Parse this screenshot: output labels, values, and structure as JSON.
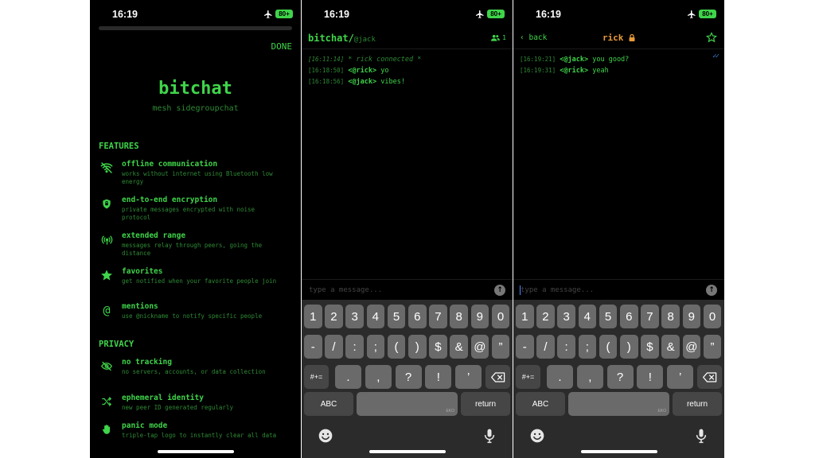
{
  "status": {
    "time": "16:19",
    "battery": "80+",
    "icons": [
      "airplane-icon",
      "battery-icon"
    ]
  },
  "settings": {
    "done_label": "DONE",
    "app_title": "bitchat",
    "app_subtitle": "mesh sidegroupchat",
    "features_header": "FEATURES",
    "privacy_header": "PRIVACY",
    "features": [
      {
        "icon": "wifi-off-icon",
        "title": "offline communication",
        "desc": "works without internet using Bluetooth low energy"
      },
      {
        "icon": "shield-icon",
        "title": "end-to-end encryption",
        "desc": "private messages encrypted with noise protocol"
      },
      {
        "icon": "antenna-icon",
        "title": "extended range",
        "desc": "messages relay through peers, going the distance"
      },
      {
        "icon": "star-icon",
        "title": "favorites",
        "desc": "get notified when your favorite people join"
      },
      {
        "icon": "at-icon",
        "title": "mentions",
        "desc": "use @nickname to notify specific people"
      }
    ],
    "privacy": [
      {
        "icon": "eye-slash-icon",
        "title": "no tracking",
        "desc": "no servers, accounts, or data collection"
      },
      {
        "icon": "shuffle-icon",
        "title": "ephemeral identity",
        "desc": "new peer ID generated regularly"
      },
      {
        "icon": "hand-icon",
        "title": "panic mode",
        "desc": "triple-tap logo to instantly clear all data"
      }
    ]
  },
  "public_chat": {
    "title": "bitchat/",
    "handle": "@jack",
    "peer_count": "1",
    "messages": [
      {
        "ts": "[16:11:14]",
        "text": "* rick connected *",
        "system": true
      },
      {
        "ts": "[16:18:50]",
        "nick": "<@rick>",
        "text": "yo"
      },
      {
        "ts": "[16:18:56]",
        "nick": "<@jack>",
        "text": "vibes!"
      }
    ],
    "input_placeholder": "type a message..."
  },
  "dm_chat": {
    "back_label": "back",
    "name": "rick",
    "read_receipt": "✓✓",
    "messages": [
      {
        "ts": "[16:19:21]",
        "nick": "<@jack>",
        "text": "you good?"
      },
      {
        "ts": "[16:19:31]",
        "nick": "<@rick>",
        "text": "yeah"
      }
    ],
    "input_placeholder": "type a message..."
  },
  "keyboard": {
    "row1": [
      "1",
      "2",
      "3",
      "4",
      "5",
      "6",
      "7",
      "8",
      "9",
      "0"
    ],
    "row2": [
      "-",
      "/",
      ":",
      ";",
      "(",
      ")",
      "$",
      "&",
      "@",
      "”"
    ],
    "row3_mode": "#+=",
    "row3": [
      ".",
      ",",
      "?",
      "!",
      "’"
    ],
    "abc_label": "ABC",
    "return_label": "return",
    "space_tag": "EKO"
  }
}
